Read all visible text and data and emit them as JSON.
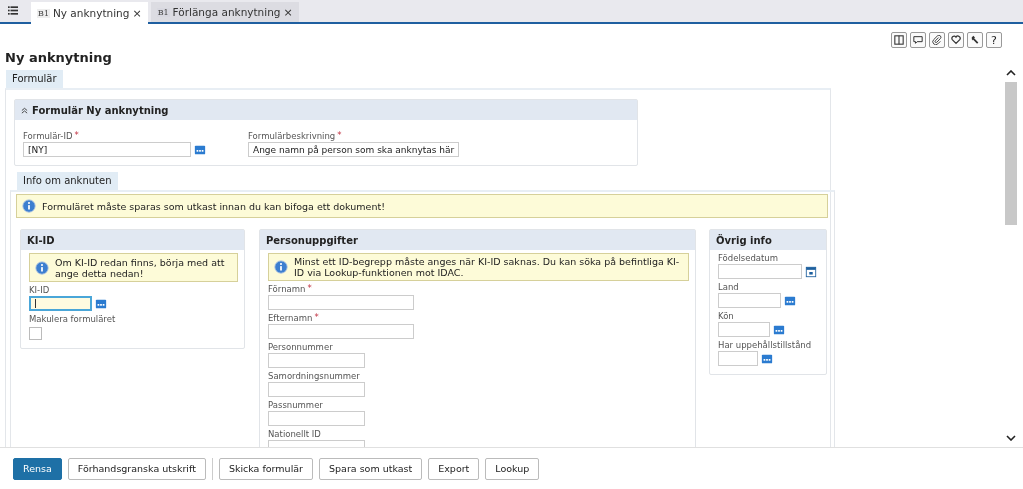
{
  "tabs": [
    {
      "badge": "B1",
      "label": "Ny anknytning",
      "close": "×",
      "selected": true
    },
    {
      "badge": "B1",
      "label": "Förlänga anknytning",
      "close": "×",
      "selected": false
    }
  ],
  "toolbar": [
    {
      "kind": "split"
    },
    {
      "kind": "comment"
    },
    {
      "kind": "attach"
    },
    {
      "kind": "heart"
    },
    {
      "kind": "wrench"
    },
    {
      "kind": "help",
      "label": "?"
    }
  ],
  "page_title": "Ny anknytning",
  "form_tab": "Formulär",
  "header_section": {
    "title": "Formulär Ny anknytning",
    "expanded": true,
    "fields": [
      {
        "label": "Formulär-ID",
        "marker": "*",
        "kind": "lookup",
        "value": "[NY]",
        "focused": false
      },
      {
        "label": "Formulärbeskrivning",
        "marker": "*",
        "kind": "auto",
        "value": "Ange  namn på person som ska anknytas här",
        "focused": false
      }
    ]
  },
  "info_tab": "Info om anknuten",
  "notice": "Formuläret måste sparas som utkast innan du kan bifoga ett dokument!",
  "panels": [
    {
      "title": "KI-ID",
      "notice": "Om KI-ID redan finns, börja med att ange detta nedan!",
      "fields": [
        {
          "label": "KI-ID",
          "kind": "lookup",
          "focused": true
        },
        {
          "label": "Makulera formuläret",
          "kind": "checkbox",
          "checked": false
        }
      ]
    },
    {
      "title": "Personuppgifter",
      "notice": "Minst ett ID-begrepp måste anges när KI-ID saknas. Du kan söka på befintliga KI-ID via Lookup-funktionen mot IDAC.",
      "fields": [
        {
          "label": "Förnamn",
          "marker": "*",
          "kind": "text",
          "focused": false
        },
        {
          "label": "Efternamn",
          "marker": "*",
          "kind": "text",
          "focused": false
        },
        {
          "label": "Personnummer",
          "kind": "short",
          "focused": false
        },
        {
          "label": "Samordningsnummer",
          "kind": "short",
          "focused": false
        },
        {
          "label": "Passnummer",
          "kind": "short",
          "focused": false
        },
        {
          "label": "Nationellt ID",
          "kind": "short",
          "focused": false
        }
      ]
    },
    {
      "title": "Övrig info",
      "fields": [
        {
          "label": "Födelsedatum",
          "kind": "date",
          "focused": false
        },
        {
          "label": "Land",
          "kind": "lookup",
          "focused": false
        },
        {
          "label": "Kön",
          "kind": "lookup",
          "focused": false
        },
        {
          "label": "Har uppehållstillstånd",
          "kind": "lookup",
          "focused": false
        }
      ]
    }
  ],
  "button_groups": [
    [
      {
        "label": "Rensa",
        "primary": true
      },
      {
        "label": "Förhandsgranska utskrift",
        "primary": false
      }
    ],
    [
      {
        "label": "Skicka formulär",
        "primary": false
      },
      {
        "label": "Spara som utkast",
        "primary": false
      },
      {
        "label": "Export",
        "primary": false
      },
      {
        "label": "Lookup",
        "primary": false
      }
    ]
  ]
}
